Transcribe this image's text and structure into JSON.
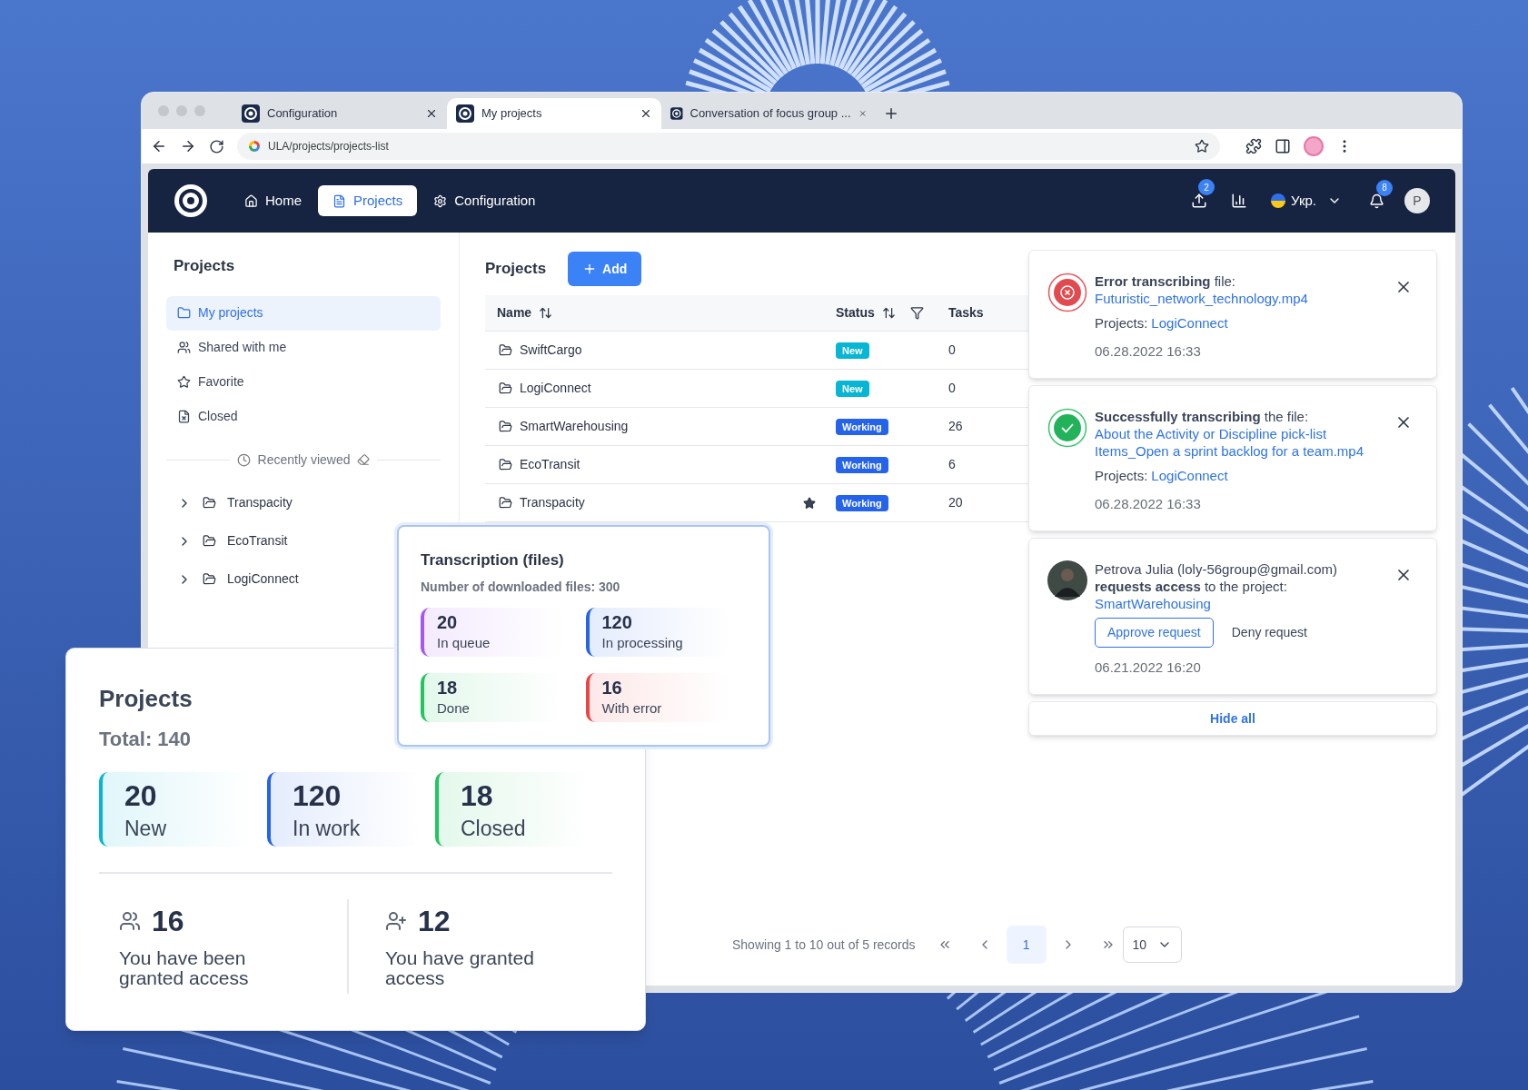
{
  "browser": {
    "tabs": [
      {
        "title": "Configuration",
        "selected": false
      },
      {
        "title": "My projects",
        "selected": true
      },
      {
        "title": "Conversation of focus group ...",
        "selected": false
      }
    ],
    "url": "ULA/projects/projects-list"
  },
  "header": {
    "nav": [
      {
        "label": "Home",
        "selected": false
      },
      {
        "label": "Projects",
        "selected": true
      },
      {
        "label": "Configuration",
        "selected": false
      }
    ],
    "upload_badge": "2",
    "language": "Укр.",
    "notifications_badge": "8",
    "avatar": "P"
  },
  "sidebar": {
    "title": "Projects",
    "items": [
      {
        "label": "My projects",
        "selected": true
      },
      {
        "label": "Shared with me",
        "selected": false
      },
      {
        "label": "Favorite",
        "selected": false
      },
      {
        "label": "Closed",
        "selected": false
      }
    ],
    "recent_title": "Recently viewed",
    "recent": [
      {
        "label": "Transpacity",
        "expanded": false
      },
      {
        "label": "EcoTransit",
        "expanded": false
      },
      {
        "label": "LogiConnect",
        "expanded": false
      }
    ]
  },
  "main": {
    "title": "Projects",
    "add_button": "Add",
    "columns": [
      {
        "label": "Name",
        "sortable": true,
        "filterable": false
      },
      {
        "label": "Status",
        "sortable": true,
        "filterable": true
      },
      {
        "label": "Tasks",
        "sortable": false,
        "filterable": false
      }
    ],
    "rows": [
      {
        "name": "SwiftCargo",
        "favorite": false,
        "status": "New",
        "kind": "new",
        "tasks": "0"
      },
      {
        "name": "LogiConnect",
        "favorite": false,
        "status": "New",
        "kind": "new",
        "tasks": "0"
      },
      {
        "name": "SmartWarehousing",
        "favorite": false,
        "status": "Working",
        "kind": "working",
        "tasks": "26"
      },
      {
        "name": "EcoTransit",
        "favorite": false,
        "status": "Working",
        "kind": "working",
        "tasks": "6"
      },
      {
        "name": "Transpacity",
        "favorite": true,
        "status": "Working",
        "kind": "working",
        "tasks": "20"
      }
    ],
    "pagination": {
      "summary": "Showing 1 to 10 out of 5 records",
      "page": "1",
      "page_size": "10"
    }
  },
  "notifications": {
    "items": [
      {
        "kind": "error",
        "message": "**Error transcribing** file:",
        "link": "Futuristic_network_technology.mp4",
        "project_label": "Projects:",
        "project": "LogiConnect",
        "time": "06.28.2022 16:33"
      },
      {
        "kind": "success",
        "message": "**Successfully transcribing** the file:",
        "link": "About the Activity or Discipline pick-list Items_Open a sprint backlog for a team.mp4",
        "project_label": "Projects:",
        "project": "LogiConnect",
        "time": "06.28.2022 16:33"
      },
      {
        "kind": "request",
        "message": "Petrova Julia (loly-56group@gmail.com) **requests access** to the project:",
        "link": "SmartWarehousing",
        "approve": "Approve request",
        "deny": "Deny request",
        "time": "06.21.2022 16:20"
      }
    ],
    "hide_all": "Hide all"
  },
  "transcription": {
    "title": "Transcription (files)",
    "subtitle": "Number of downloaded files: 300",
    "stats": [
      {
        "value": "20",
        "label": "In queue",
        "color": "#a855f7"
      },
      {
        "value": "120",
        "label": "In processing",
        "color": "#2563eb"
      },
      {
        "value": "18",
        "label": "Done",
        "color": "#22c55e"
      },
      {
        "value": "16",
        "label": "With error",
        "color": "#ef4444"
      }
    ]
  },
  "projects_card": {
    "title": "Projects",
    "total": "Total: 140",
    "stats": [
      {
        "value": "20",
        "label": "New",
        "color": "#06b6d4"
      },
      {
        "value": "120",
        "label": "In work",
        "color": "#2563eb"
      },
      {
        "value": "18",
        "label": "Closed",
        "color": "#22c55e"
      }
    ],
    "access": [
      {
        "value": "16",
        "label": "You have been granted access"
      },
      {
        "value": "12",
        "label": "You have granted access"
      }
    ]
  }
}
